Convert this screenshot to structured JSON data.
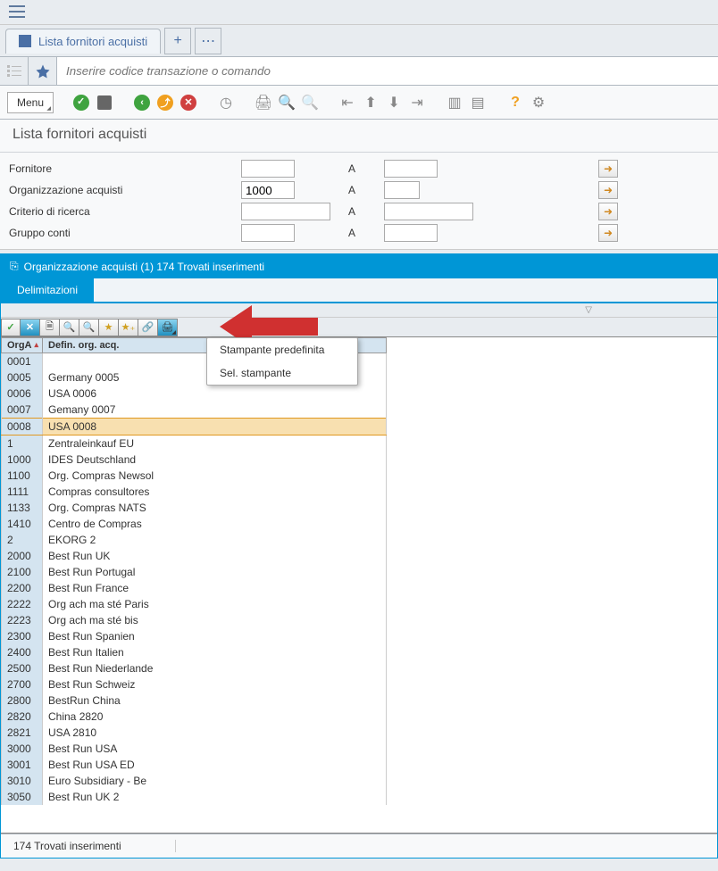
{
  "tab": {
    "title": "Lista fornitori acquisti"
  },
  "cmd": {
    "placeholder": "Inserire codice transazione o comando"
  },
  "toolbar": {
    "menu": "Menu"
  },
  "page": {
    "title": "Lista fornitori acquisti"
  },
  "filters": {
    "labels": [
      "Fornitore",
      "Organizzazione acquisti",
      "Criterio di ricerca",
      "Gruppo conti"
    ],
    "to": "A",
    "org_value": "1000"
  },
  "subwin": {
    "title": "Organizzazione acquisti (1)   174 Trovati inserimenti",
    "tab": "Delimitazioni"
  },
  "dropdown": {
    "items": [
      "Stampante predefinita",
      "Sel. stampante"
    ]
  },
  "grid": {
    "headers": [
      "OrgA",
      "Defin. org. acq."
    ],
    "rows": [
      {
        "code": "0001",
        "desc": ""
      },
      {
        "code": "0005",
        "desc": "Germany 0005"
      },
      {
        "code": "0006",
        "desc": "USA 0006"
      },
      {
        "code": "0007",
        "desc": "Gemany 0007"
      },
      {
        "code": "0008",
        "desc": "USA 0008",
        "selected": true
      },
      {
        "code": "1",
        "desc": "Zentraleinkauf EU"
      },
      {
        "code": "1000",
        "desc": "IDES Deutschland"
      },
      {
        "code": "1100",
        "desc": "Org. Compras Newsol"
      },
      {
        "code": "1111",
        "desc": "Compras consultores"
      },
      {
        "code": "1133",
        "desc": "Org. Compras NATS"
      },
      {
        "code": "1410",
        "desc": "Centro de Compras"
      },
      {
        "code": "2",
        "desc": "EKORG 2"
      },
      {
        "code": "2000",
        "desc": "Best Run UK"
      },
      {
        "code": "2100",
        "desc": "Best Run Portugal"
      },
      {
        "code": "2200",
        "desc": "Best Run France"
      },
      {
        "code": "2222",
        "desc": "Org ach ma sté Paris"
      },
      {
        "code": "2223",
        "desc": "Org ach ma sté bis"
      },
      {
        "code": "2300",
        "desc": "Best Run Spanien"
      },
      {
        "code": "2400",
        "desc": "Best Run Italien"
      },
      {
        "code": "2500",
        "desc": "Best Run Niederlande"
      },
      {
        "code": "2700",
        "desc": "Best Run Schweiz"
      },
      {
        "code": "2800",
        "desc": "BestRun China"
      },
      {
        "code": "2820",
        "desc": "China 2820"
      },
      {
        "code": "2821",
        "desc": "USA 2810"
      },
      {
        "code": "3000",
        "desc": "Best Run USA"
      },
      {
        "code": "3001",
        "desc": "Best Run USA ED"
      },
      {
        "code": "3010",
        "desc": "Euro Subsidiary - Be"
      },
      {
        "code": "3050",
        "desc": "Best Run UK 2"
      }
    ]
  },
  "status": {
    "text": "174 Trovati inserimenti"
  }
}
